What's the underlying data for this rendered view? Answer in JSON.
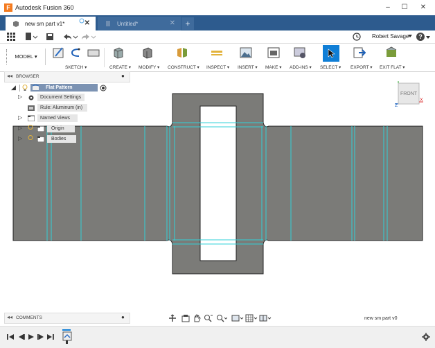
{
  "window": {
    "title": "Autodesk Fusion 360",
    "logo_letter": "F",
    "minimize": "–",
    "maximize": "☐",
    "close": "✕"
  },
  "tabs": [
    {
      "label": "new sm part v1*",
      "active": true
    },
    {
      "label": "Untitled*",
      "active": false
    }
  ],
  "quick_access": {
    "user": "Robert Savage",
    "help": "?"
  },
  "toolbar": {
    "workspace": "MODEL",
    "groups": [
      "SKETCH",
      "CREATE",
      "MODIFY",
      "CONSTRUCT",
      "INSPECT",
      "INSERT",
      "MAKE",
      "ADD-INS",
      "SELECT",
      "EXPORT",
      "EXIT FLAT"
    ]
  },
  "browser": {
    "title": "BROWSER",
    "root": "Flat Pattern",
    "items": [
      "Document Settings",
      "Rule: Aluminum (in)",
      "Named Views",
      "Origin",
      "Bodies"
    ]
  },
  "viewcube": {
    "face": "FRONT",
    "axis_y": "Y",
    "axis_x": "X",
    "axis_z": "Z"
  },
  "comments": {
    "title": "COMMENTS"
  },
  "status": {
    "document_name": "new sm part v0"
  },
  "colors": {
    "tabbar": "#2d5b8e",
    "part_fill": "#7b7b78",
    "bend_lines": "#32d1d8",
    "select_blue": "#0f7ed6"
  }
}
